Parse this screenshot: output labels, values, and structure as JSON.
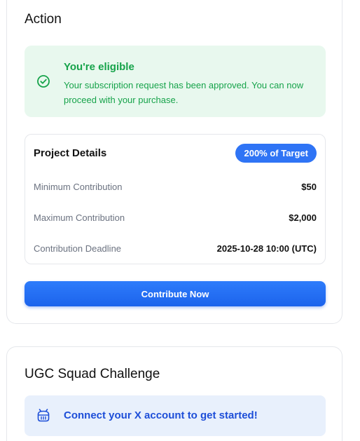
{
  "action": {
    "title": "Action",
    "eligibility": {
      "title": "You're eligible",
      "message": "Your subscription request has been approved. You can now proceed with your purchase.",
      "icon": "check-circle-icon",
      "color": "#16a34a"
    },
    "project_details": {
      "title": "Project Details",
      "badge": "200% of Target",
      "rows": [
        {
          "label": "Minimum Contribution",
          "value": "$50"
        },
        {
          "label": "Maximum Contribution",
          "value": "$2,000"
        },
        {
          "label": "Contribution Deadline",
          "value": "2025-10-28 10:00 (UTC)"
        }
      ]
    },
    "contribute_label": "Contribute Now",
    "accent": "#2f74f5"
  },
  "ugc": {
    "title": "UGC Squad Challenge",
    "connect_text": "Connect your X account to get started!",
    "icon": "robot-icon"
  }
}
